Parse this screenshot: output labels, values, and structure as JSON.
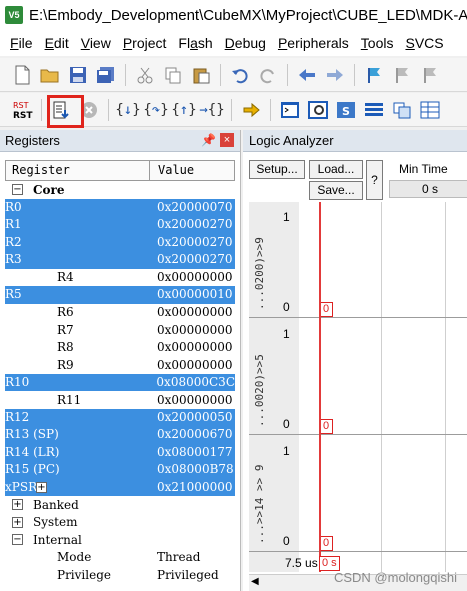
{
  "window": {
    "title": "E:\\Embody_Development\\CubeMX\\MyProject\\CUBE_LED\\MDK-ARM\\CUBE_LED.uvprojx - µVision",
    "app_icon": "uvision-icon"
  },
  "menu": [
    {
      "label": "File",
      "u": "F",
      "rest": "ile"
    },
    {
      "label": "Edit",
      "u": "E",
      "rest": "dit"
    },
    {
      "label": "View",
      "u": "V",
      "rest": "iew"
    },
    {
      "label": "Project",
      "u": "P",
      "rest": "roject"
    },
    {
      "label": "Flash",
      "pre": "Fl",
      "u": "a",
      "rest": "sh"
    },
    {
      "label": "Debug",
      "u": "D",
      "rest": "ebug"
    },
    {
      "label": "Peripherals",
      "u": "P",
      "rest": "eripherals"
    },
    {
      "label": "Tools",
      "u": "T",
      "rest": "ools"
    },
    {
      "label": "SVCS",
      "u": "S",
      "rest": "VCS"
    }
  ],
  "registers": {
    "panel_title": "Registers",
    "col_register": "Register",
    "col_value": "Value",
    "core_label": "Core",
    "rows": [
      {
        "name": "R0",
        "value": "0x20000070",
        "sel": true
      },
      {
        "name": "R1",
        "value": "0x20000270",
        "sel": true
      },
      {
        "name": "R2",
        "value": "0x20000270",
        "sel": true
      },
      {
        "name": "R3",
        "value": "0x20000270",
        "sel": true
      },
      {
        "name": "R4",
        "value": "0x00000000",
        "sel": false
      },
      {
        "name": "R5",
        "value": "0x00000010",
        "sel": true
      },
      {
        "name": "R6",
        "value": "0x00000000",
        "sel": false
      },
      {
        "name": "R7",
        "value": "0x00000000",
        "sel": false
      },
      {
        "name": "R8",
        "value": "0x00000000",
        "sel": false
      },
      {
        "name": "R9",
        "value": "0x00000000",
        "sel": false
      },
      {
        "name": "R10",
        "value": "0x08000C3C",
        "sel": true
      },
      {
        "name": "R11",
        "value": "0x00000000",
        "sel": false
      },
      {
        "name": "R12",
        "value": "0x20000050",
        "sel": true
      },
      {
        "name": "R13 (SP)",
        "value": "0x20000670",
        "sel": true
      },
      {
        "name": "R14 (LR)",
        "value": "0x08000177",
        "sel": true
      },
      {
        "name": "R15 (PC)",
        "value": "0x08000B78",
        "sel": true
      },
      {
        "name": "xPSR",
        "value": "0x21000000",
        "sel": true
      }
    ],
    "banked_label": "Banked",
    "system_label": "System",
    "internal_label": "Internal",
    "mode_name": "Mode",
    "mode_value": "Thread",
    "privilege_name": "Privilege",
    "privilege_value": "Privileged"
  },
  "logic_analyzer": {
    "panel_title": "Logic Analyzer",
    "setup_label": "Setup...",
    "load_label": "Load...",
    "save_label": "Save...",
    "help_label": "?",
    "min_time_label": "Min Time",
    "min_time_value": "0 s",
    "signals": [
      {
        "name": "...0200)>>9",
        "top": "1",
        "bottom": "0",
        "marker": "0"
      },
      {
        "name": "...0020)>>5",
        "top": "1",
        "bottom": "0",
        "marker": "0"
      },
      {
        "name": "...>>14 >> 9",
        "top": "1",
        "bottom": "0",
        "marker": "0"
      }
    ],
    "bottom_left": "7.5 us",
    "bottom_marker": "0 s"
  },
  "watermark": "CSDN @molongqishi"
}
